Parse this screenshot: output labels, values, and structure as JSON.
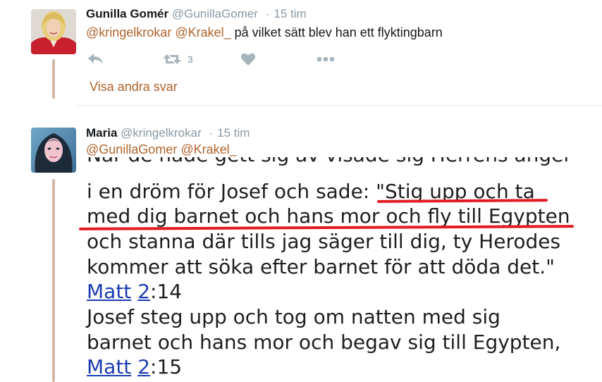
{
  "tweet1": {
    "author_name": "Gunilla Gomér",
    "author_handle": "@GunillaGomer",
    "separator": "·",
    "time": "15 tim",
    "mention1": "@kringelkrokar",
    "mention2": "@Krakel_",
    "text": "på vilket sätt blev han ett flyktingbarn",
    "retweet_count": "3"
  },
  "show_more_label": "Visa andra svar",
  "tweet2": {
    "author_name": "Maria",
    "author_handle": "@kringelkrokar",
    "separator": "·",
    "time": "15 tim",
    "mention1": "@GunillaGomer",
    "mention2": "@Krakel_",
    "image_text": {
      "line0": "När de hade gett sig av visade sig Herrens ängel",
      "line1": "i en dröm för Josef och sade: \"Stig upp och ta",
      "line2": "med dig barnet och hans mor och fly till Egypten",
      "line3": "och stanna där tills jag säger till dig, ty Herodes",
      "line4": "kommer att söka efter barnet för att döda det.\"",
      "ref1_book": "Matt",
      "ref1_chapter": "2",
      "ref1_verse": ":14",
      "line6": "Josef steg upp och tog om natten med sig",
      "line7": "barnet och hans mor och begav sig till Egypten,",
      "ref2_book": "Matt",
      "ref2_chapter": "2",
      "ref2_verse": ":15"
    }
  },
  "colors": {
    "link": "#b0632a",
    "thread_line": "#d1b8a6",
    "action_icon": "#a5b3bd",
    "highlight_red": "#e21b23",
    "bible_link": "#1a3cb0"
  }
}
